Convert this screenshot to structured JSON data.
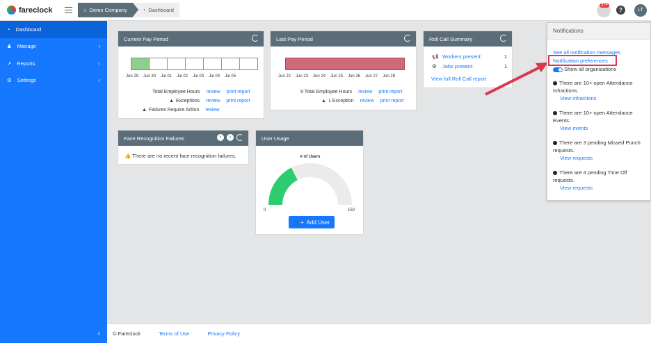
{
  "app": {
    "name": "fareclock"
  },
  "breadcrumb": {
    "company": "Demo Company",
    "page": "Dashboard"
  },
  "header": {
    "badge": "27+",
    "avatar": "LT",
    "help": "?"
  },
  "sidebar": {
    "items": [
      {
        "label": "Dashboard"
      },
      {
        "label": "Manage"
      },
      {
        "label": "Reports"
      },
      {
        "label": "Settings"
      }
    ]
  },
  "current_pay_period": {
    "title": "Current Pay Period",
    "dates": [
      "Jun 29",
      "Jun 30",
      "Jul 01",
      "Jul 02",
      "Jul 03",
      "Jul 04",
      "Jul 05"
    ],
    "rows": [
      {
        "label": "Total Employee Hours",
        "link1": "review",
        "link2": "print report"
      },
      {
        "label": "Exceptions",
        "link1": "review",
        "link2": "print report"
      },
      {
        "label": "Failures Require Action",
        "link1": "review"
      }
    ]
  },
  "last_pay_period": {
    "title": "Last Pay Period",
    "dates": [
      "Jun 22",
      "Jun 23",
      "Jun 24",
      "Jun 25",
      "Jun 26",
      "Jun 27",
      "Jun 28"
    ],
    "rows": [
      {
        "label": "9 Total Employee Hours",
        "link1": "review",
        "link2": "print report"
      },
      {
        "label": "1 Exception",
        "link1": "review",
        "link2": "print report"
      }
    ]
  },
  "roll_call": {
    "title": "Roll Call Summary",
    "workers_label": "Workers present:",
    "workers_value": "1",
    "jobs_label": "Jobs present:",
    "jobs_value": "1",
    "report_link": "View full Roll Call report"
  },
  "face_recognition": {
    "title": "Face Recognition Failures",
    "message": "There are no recent face recognition failures."
  },
  "user_usage": {
    "title": "User Usage",
    "gauge_label": "# of Users",
    "min": "0",
    "max": "150",
    "value_fraction": 0.35,
    "button": "Add User"
  },
  "footer": {
    "copyright": "© Fareclock",
    "terms": "Terms of Use",
    "privacy": "Privacy Policy"
  },
  "notifications": {
    "title": "Notifications",
    "see_all": "See all notification messages",
    "preferences": "Notification preferences",
    "show_all": "Show all organizations",
    "items": [
      {
        "text": "There are 10+ open Attendance Infractions.",
        "link": "View infractions"
      },
      {
        "text": "There are 10+ open Attendance Events.",
        "link": "View events"
      },
      {
        "text": "There are 3 pending Missed Punch requests.",
        "link": "View requests"
      },
      {
        "text": "There are 4 pending Time Off requests.",
        "link": "View requests"
      }
    ]
  }
}
